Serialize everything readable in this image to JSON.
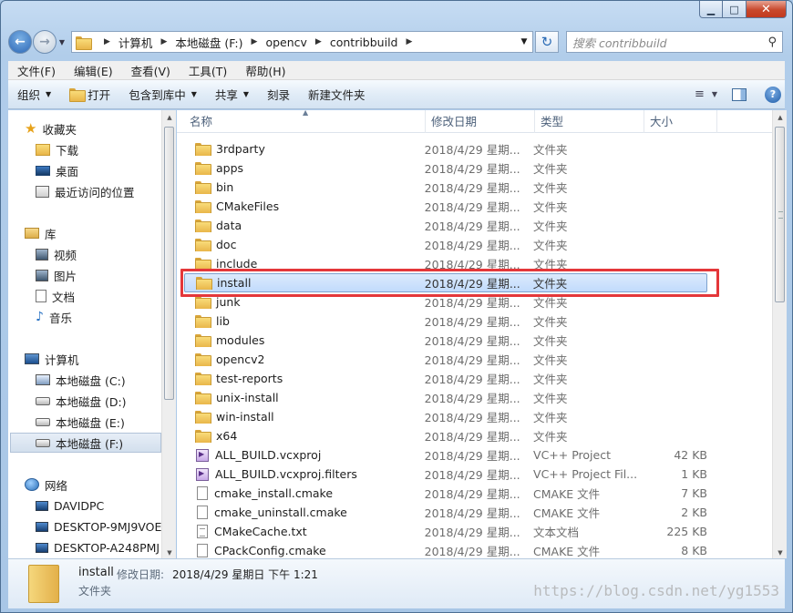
{
  "window": {
    "caption_min": "▁",
    "caption_max": "□",
    "caption_close": "✕"
  },
  "address": {
    "breadcrumbs": [
      "计算机",
      "本地磁盘 (F:)",
      "opencv",
      "contribbuild"
    ],
    "search_placeholder": "搜索 contribbuild"
  },
  "menubar": [
    "文件(F)",
    "编辑(E)",
    "查看(V)",
    "工具(T)",
    "帮助(H)"
  ],
  "toolbar": {
    "organize": "组织",
    "open": "打开",
    "include_in_library": "包含到库中",
    "share": "共享",
    "burn": "刻录",
    "new_folder": "新建文件夹"
  },
  "nav": {
    "favorites": {
      "label": "收藏夹",
      "items": [
        "下载",
        "桌面",
        "最近访问的位置"
      ]
    },
    "libraries": {
      "label": "库",
      "items": [
        "视频",
        "图片",
        "文档",
        "音乐"
      ]
    },
    "computer": {
      "label": "计算机",
      "items": [
        "本地磁盘 (C:)",
        "本地磁盘 (D:)",
        "本地磁盘 (E:)",
        "本地磁盘 (F:)"
      ]
    },
    "network": {
      "label": "网络",
      "items": [
        "DAVIDPC",
        "DESKTOP-9MJ9VOE",
        "DESKTOP-A248PMJ"
      ]
    }
  },
  "columns": {
    "name": "名称",
    "date": "修改日期",
    "type": "类型",
    "size": "大小"
  },
  "files": [
    {
      "name": "3rdparty",
      "date": "2018/4/29 星期...",
      "type": "文件夹",
      "size": "",
      "kind": "folder"
    },
    {
      "name": "apps",
      "date": "2018/4/29 星期...",
      "type": "文件夹",
      "size": "",
      "kind": "folder"
    },
    {
      "name": "bin",
      "date": "2018/4/29 星期...",
      "type": "文件夹",
      "size": "",
      "kind": "folder"
    },
    {
      "name": "CMakeFiles",
      "date": "2018/4/29 星期...",
      "type": "文件夹",
      "size": "",
      "kind": "folder"
    },
    {
      "name": "data",
      "date": "2018/4/29 星期...",
      "type": "文件夹",
      "size": "",
      "kind": "folder"
    },
    {
      "name": "doc",
      "date": "2018/4/29 星期...",
      "type": "文件夹",
      "size": "",
      "kind": "folder"
    },
    {
      "name": "include",
      "date": "2018/4/29 星期...",
      "type": "文件夹",
      "size": "",
      "kind": "folder"
    },
    {
      "name": "install",
      "date": "2018/4/29 星期...",
      "type": "文件夹",
      "size": "",
      "kind": "folder"
    },
    {
      "name": "junk",
      "date": "2018/4/29 星期...",
      "type": "文件夹",
      "size": "",
      "kind": "folder"
    },
    {
      "name": "lib",
      "date": "2018/4/29 星期...",
      "type": "文件夹",
      "size": "",
      "kind": "folder"
    },
    {
      "name": "modules",
      "date": "2018/4/29 星期...",
      "type": "文件夹",
      "size": "",
      "kind": "folder"
    },
    {
      "name": "opencv2",
      "date": "2018/4/29 星期...",
      "type": "文件夹",
      "size": "",
      "kind": "folder"
    },
    {
      "name": "test-reports",
      "date": "2018/4/29 星期...",
      "type": "文件夹",
      "size": "",
      "kind": "folder"
    },
    {
      "name": "unix-install",
      "date": "2018/4/29 星期...",
      "type": "文件夹",
      "size": "",
      "kind": "folder"
    },
    {
      "name": "win-install",
      "date": "2018/4/29 星期...",
      "type": "文件夹",
      "size": "",
      "kind": "folder"
    },
    {
      "name": "x64",
      "date": "2018/4/29 星期...",
      "type": "文件夹",
      "size": "",
      "kind": "folder"
    },
    {
      "name": "ALL_BUILD.vcxproj",
      "date": "2018/4/29 星期...",
      "type": "VC++ Project",
      "size": "42 KB",
      "kind": "vcx"
    },
    {
      "name": "ALL_BUILD.vcxproj.filters",
      "date": "2018/4/29 星期...",
      "type": "VC++ Project Fil...",
      "size": "1 KB",
      "kind": "vcx"
    },
    {
      "name": "cmake_install.cmake",
      "date": "2018/4/29 星期...",
      "type": "CMAKE 文件",
      "size": "7 KB",
      "kind": "file"
    },
    {
      "name": "cmake_uninstall.cmake",
      "date": "2018/4/29 星期...",
      "type": "CMAKE 文件",
      "size": "2 KB",
      "kind": "file"
    },
    {
      "name": "CMakeCache.txt",
      "date": "2018/4/29 星期...",
      "type": "文本文档",
      "size": "225 KB",
      "kind": "txt"
    },
    {
      "name": "CPackConfig.cmake",
      "date": "2018/4/29 星期...",
      "type": "CMAKE 文件",
      "size": "8 KB",
      "kind": "file"
    }
  ],
  "selected_index": 7,
  "details": {
    "name": "install",
    "date_label": "修改日期:",
    "date_value": "2018/4/29 星期日 下午 1:21",
    "type": "文件夹"
  },
  "watermark": "https://blog.csdn.net/yg1553",
  "colors": {
    "highlight_box": "#e4373a",
    "selection": "#c1dbfc"
  }
}
